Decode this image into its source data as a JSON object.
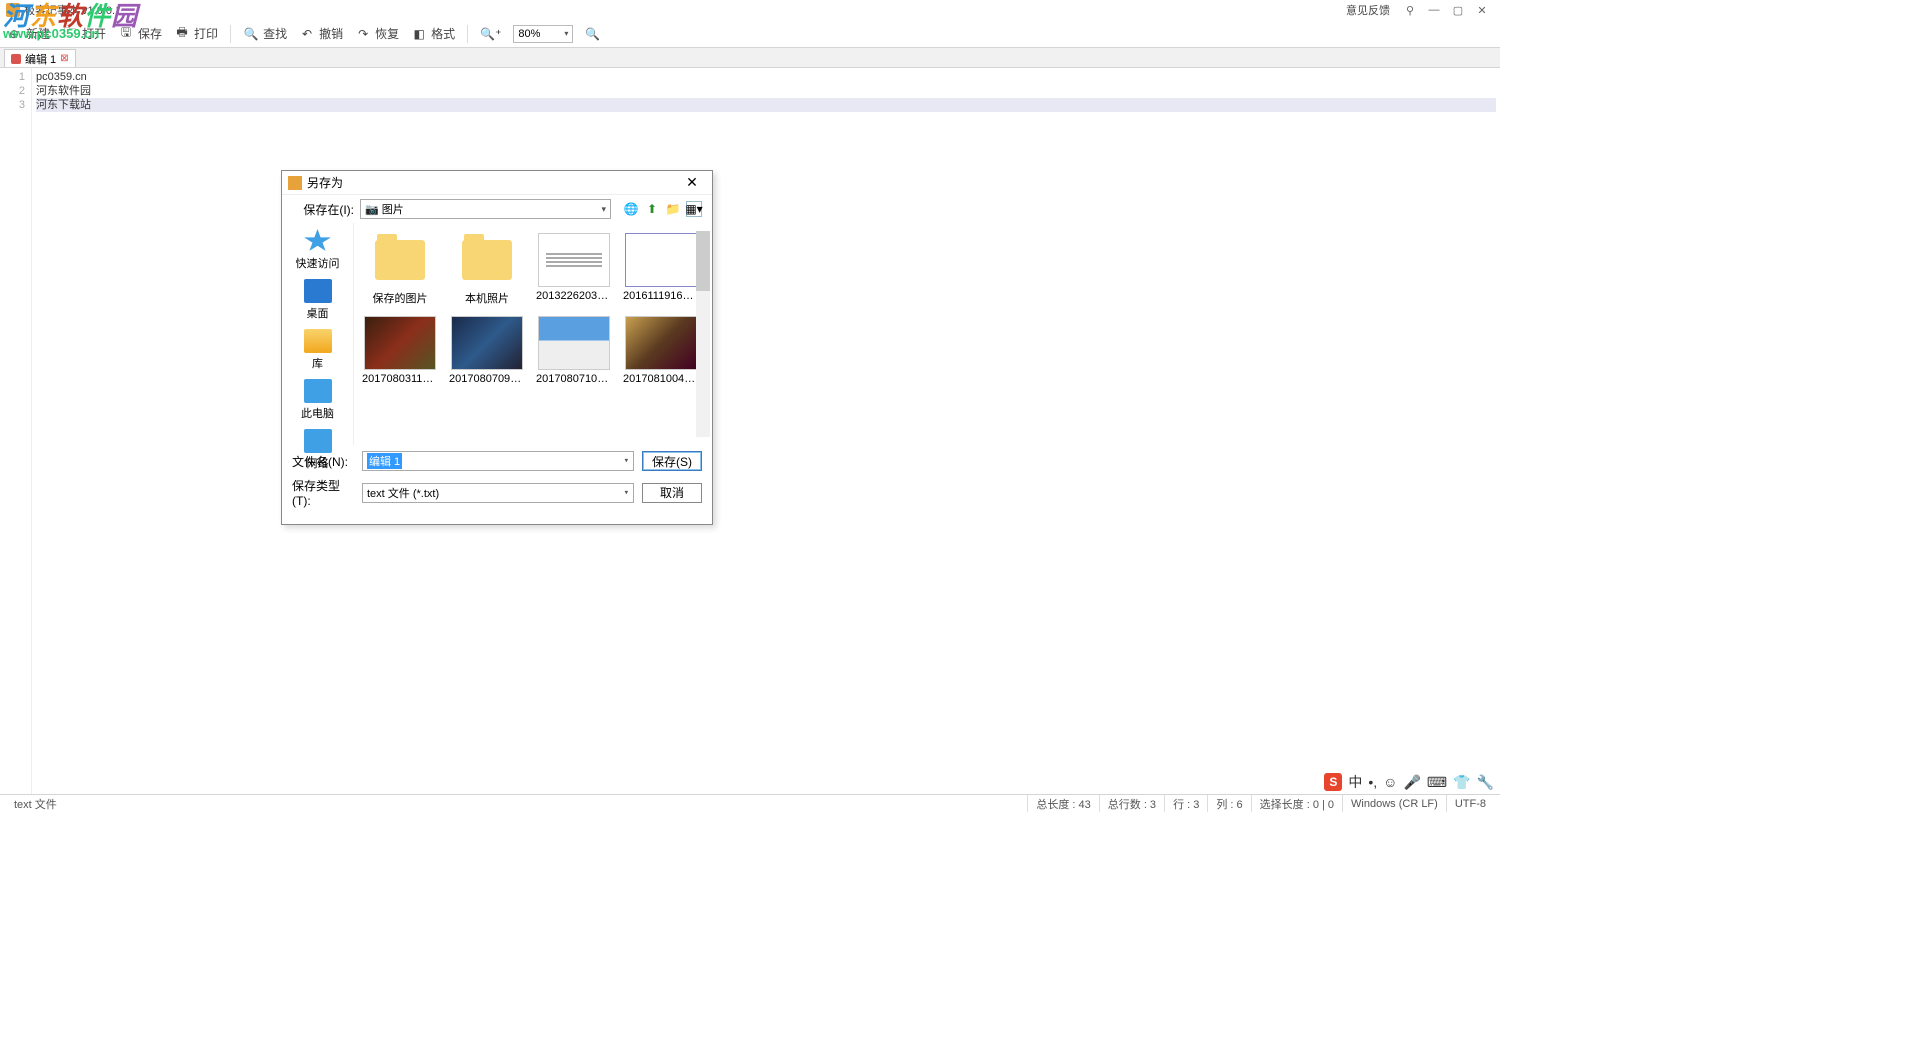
{
  "titlebar": {
    "title": "极客记事本 v1.0.0.1",
    "feedback": "意见反馈"
  },
  "watermark": {
    "cn": "河东软件园",
    "url": "www.pc0359.cn"
  },
  "toolbar": {
    "new": "新建",
    "open": "打开",
    "save": "保存",
    "print": "打印",
    "find": "查找",
    "undo": "撤销",
    "redo": "恢复",
    "format": "格式",
    "zoom_value": "80%"
  },
  "tab": {
    "label": "编辑 1"
  },
  "editor": {
    "lines": [
      "pc0359.cn",
      "河东软件园",
      "河东下载站"
    ],
    "selected_line_index": 2
  },
  "dialog": {
    "title": "另存为",
    "save_in_label": "保存在(I):",
    "save_in_value": "图片",
    "places": {
      "quick": "快速访问",
      "desktop": "桌面",
      "library": "库",
      "thispc": "此电脑",
      "network": "网络"
    },
    "files": [
      {
        "name": "保存的图片",
        "type": "folder"
      },
      {
        "name": "本机照片",
        "type": "folder"
      },
      {
        "name": "201322620352...",
        "type": "doc"
      },
      {
        "name": "201611191624...",
        "type": "doc2"
      },
      {
        "name": "201708031107...",
        "type": "img1"
      },
      {
        "name": "201708070936...",
        "type": "img2"
      },
      {
        "name": "201708071009...",
        "type": "img3"
      },
      {
        "name": "201708100401...",
        "type": "img4"
      }
    ],
    "filename_label": "文件名(N):",
    "filename_value": "编辑 1",
    "filetype_label": "保存类型(T):",
    "filetype_value": "text 文件 (*.txt)",
    "save_btn": "保存(S)",
    "cancel_btn": "取消"
  },
  "status": {
    "filetype": "text 文件",
    "total_len": "总长度 : 43",
    "total_lines": "总行数 : 3",
    "row": "行 : 3",
    "col": "列 : 6",
    "sel": "选择长度 : 0 | 0",
    "eol": "Windows (CR LF)",
    "encoding": "UTF-8"
  },
  "tray": {
    "ime": "中"
  }
}
